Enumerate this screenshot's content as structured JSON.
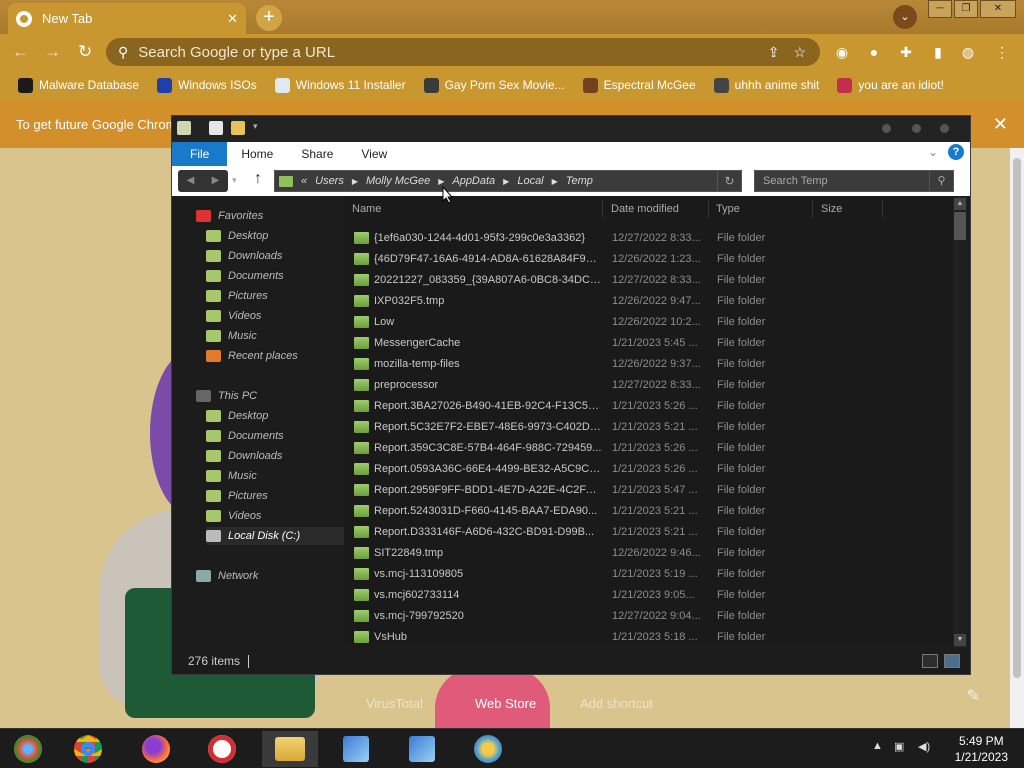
{
  "browser": {
    "tab_title": "New Tab",
    "tab_close": "✕",
    "new_tab": "+",
    "omnibox_placeholder": "Search Google or type a URL",
    "bookmarks": [
      {
        "label": "Malware Database",
        "icon": "skull-icon",
        "color": "#1a1a1a"
      },
      {
        "label": "Windows ISOs",
        "icon": "x-logo-icon",
        "color": "#1f3fae"
      },
      {
        "label": "Windows 11 Installer",
        "icon": "image-icon",
        "color": "#dfe9f1"
      },
      {
        "label": "Gay Porn Sex Movie...",
        "icon": "globe-icon",
        "color": "#3a3a3a"
      },
      {
        "label": "Espectral McGee",
        "icon": "avatar-icon",
        "color": "#704020"
      },
      {
        "label": "uhhh anime shit",
        "icon": "anime-icon",
        "color": "#444"
      },
      {
        "label": "you are an idiot!",
        "icon": "flag-icon",
        "color": "#c0304a"
      }
    ],
    "infobar_text": "To get future Google Chrom",
    "ntp_shortcuts": [
      "VirusTotal",
      "Web Store",
      "Add shortcut"
    ]
  },
  "explorer": {
    "ribbon_tabs": [
      "File",
      "Home",
      "Share",
      "View"
    ],
    "path": [
      "Users",
      "Molly McGee",
      "AppData",
      "Local",
      "Temp"
    ],
    "path_prefix": "«",
    "search_placeholder": "Search Temp",
    "nav": {
      "favorites_label": "Favorites",
      "favorites": [
        "Desktop",
        "Downloads",
        "Documents",
        "Pictures",
        "Videos",
        "Music",
        "Recent places"
      ],
      "thispc_label": "This PC",
      "thispc": [
        "Desktop",
        "Documents",
        "Downloads",
        "Music",
        "Pictures",
        "Videos",
        "Local Disk (C:)"
      ],
      "network_label": "Network"
    },
    "columns": [
      "Name",
      "Date modified",
      "Type",
      "Size"
    ],
    "rows": [
      {
        "name": "{1ef6a030-1244-4d01-95f3-299c0e3a3362}",
        "date": "12/27/2022 8:33...",
        "type": "File folder"
      },
      {
        "name": "{46D79F47-16A6-4914-AD8A-61628A84F99C}",
        "date": "12/26/2022 1:23...",
        "type": "File folder"
      },
      {
        "name": "20221227_083359_{39A807A6-0BC8-34DC-...",
        "date": "12/27/2022 8:33...",
        "type": "File folder"
      },
      {
        "name": "IXP032F5.tmp",
        "date": "12/26/2022 9:47...",
        "type": "File folder"
      },
      {
        "name": "Low",
        "date": "12/26/2022 10:2...",
        "type": "File folder"
      },
      {
        "name": "MessengerCache",
        "date": "1/21/2023 5:45 ...",
        "type": "File folder"
      },
      {
        "name": "mozilla-temp-files",
        "date": "12/26/2022 9:37...",
        "type": "File folder"
      },
      {
        "name": "preprocessor",
        "date": "12/27/2022 8:33...",
        "type": "File folder"
      },
      {
        "name": "Report.3BA27026-B490-41EB-92C4-F13C52...",
        "date": "1/21/2023 5:26 ...",
        "type": "File folder"
      },
      {
        "name": "Report.5C32E7F2-EBE7-48E6-9973-C402D5...",
        "date": "1/21/2023 5:21 ...",
        "type": "File folder"
      },
      {
        "name": "Report.359C3C8E-57B4-464F-988C-729459...",
        "date": "1/21/2023 5:26 ...",
        "type": "File folder"
      },
      {
        "name": "Report.0593A36C-66E4-4499-BE32-A5C9C1...",
        "date": "1/21/2023 5:26 ...",
        "type": "File folder"
      },
      {
        "name": "Report.2959F9FF-BDD1-4E7D-A22E-4C2FA...",
        "date": "1/21/2023 5:47 ...",
        "type": "File folder"
      },
      {
        "name": "Report.5243031D-F660-4145-BAA7-EDA90...",
        "date": "1/21/2023 5:21 ...",
        "type": "File folder"
      },
      {
        "name": "Report.D333146F-A6D6-432C-BD91-D99B...",
        "date": "1/21/2023 5:21 ...",
        "type": "File folder"
      },
      {
        "name": "SIT22849.tmp",
        "date": "12/26/2022 9:46...",
        "type": "File folder"
      },
      {
        "name": "vs.mcj-113109805",
        "date": "1/21/2023 5:19 ...",
        "type": "File folder"
      },
      {
        "name": "vs.mcj602733114",
        "date": "1/21/2023 9:05...",
        "type": "File folder"
      },
      {
        "name": "vs.mcj-799792520",
        "date": "12/27/2022 9:04...",
        "type": "File folder"
      },
      {
        "name": "VsHub",
        "date": "1/21/2023 5:18 ...",
        "type": "File folder"
      }
    ],
    "status_count": "276 items"
  },
  "taskbar": {
    "apps": [
      "start-orb",
      "chrome",
      "firefox",
      "opera",
      "file-explorer",
      "network-app-1",
      "network-app-2",
      "network-app-3"
    ],
    "time": "5:49 PM",
    "date": "1/21/2023"
  },
  "colors": {
    "accent": "#1979ca",
    "chrome_frame": "#c8972f",
    "folder": "#8fbf5a"
  }
}
